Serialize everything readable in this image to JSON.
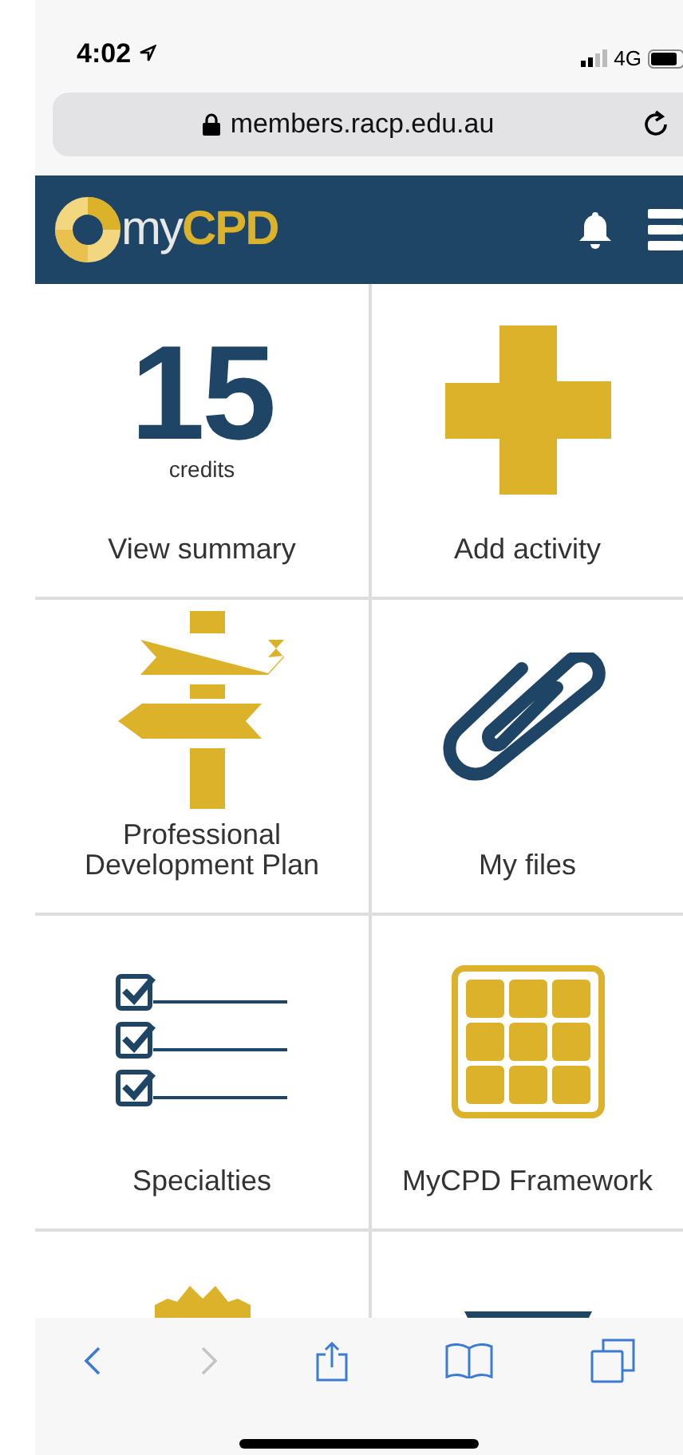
{
  "status_bar": {
    "time": "4:02",
    "network": "4G"
  },
  "address_bar": {
    "url": "members.racp.edu.au"
  },
  "header": {
    "logo_light": "my",
    "logo_bold": "CPD"
  },
  "tiles": [
    {
      "kind": "credits",
      "number": "15",
      "unit": "credits",
      "label": "View summary"
    },
    {
      "kind": "plus",
      "label": "Add activity"
    },
    {
      "kind": "signpost",
      "label": "Professional Development Plan"
    },
    {
      "kind": "paperclip",
      "label": "My files"
    },
    {
      "kind": "checklist",
      "label": "Specialties"
    },
    {
      "kind": "grid",
      "label": "MyCPD Framework"
    },
    {
      "kind": "badge"
    },
    {
      "kind": "bar"
    }
  ]
}
